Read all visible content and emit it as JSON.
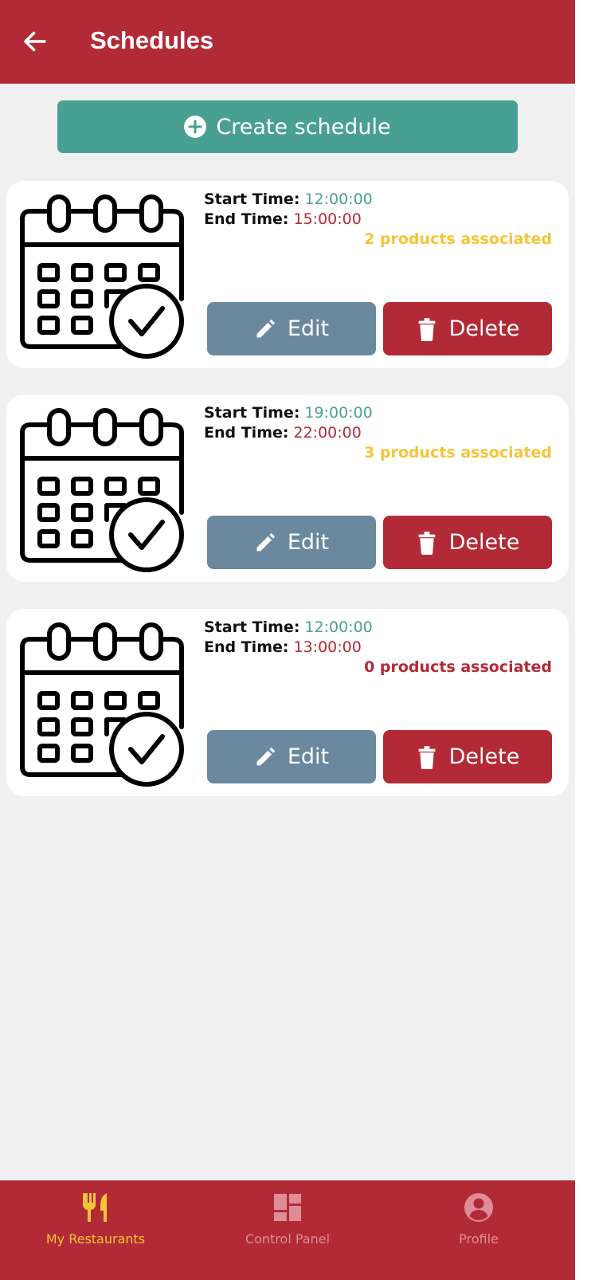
{
  "header": {
    "title": "Schedules"
  },
  "create_button": {
    "label": "Create schedule"
  },
  "labels": {
    "start": "Start Time:",
    "end": "End Time:",
    "edit": "Edit",
    "delete": "Delete"
  },
  "schedules": [
    {
      "start": "12:00:00",
      "end": "15:00:00",
      "products": "2 products associated",
      "products_color": "#f4c535"
    },
    {
      "start": "19:00:00",
      "end": "22:00:00",
      "products": "3 products associated",
      "products_color": "#f4c535"
    },
    {
      "start": "12:00:00",
      "end": "13:00:00",
      "products": "0 products associated",
      "products_color": "#b22a36"
    }
  ],
  "tabs": [
    {
      "label": "My Restaurants",
      "icon": "utensils-icon",
      "active": true
    },
    {
      "label": "Control Panel",
      "icon": "dashboard-icon",
      "active": false
    },
    {
      "label": "Profile",
      "icon": "user-circle-icon",
      "active": false
    }
  ],
  "colors": {
    "primary": "#b22a36",
    "accent": "#48a093",
    "edit": "#6a889e",
    "highlight": "#f4c535"
  }
}
